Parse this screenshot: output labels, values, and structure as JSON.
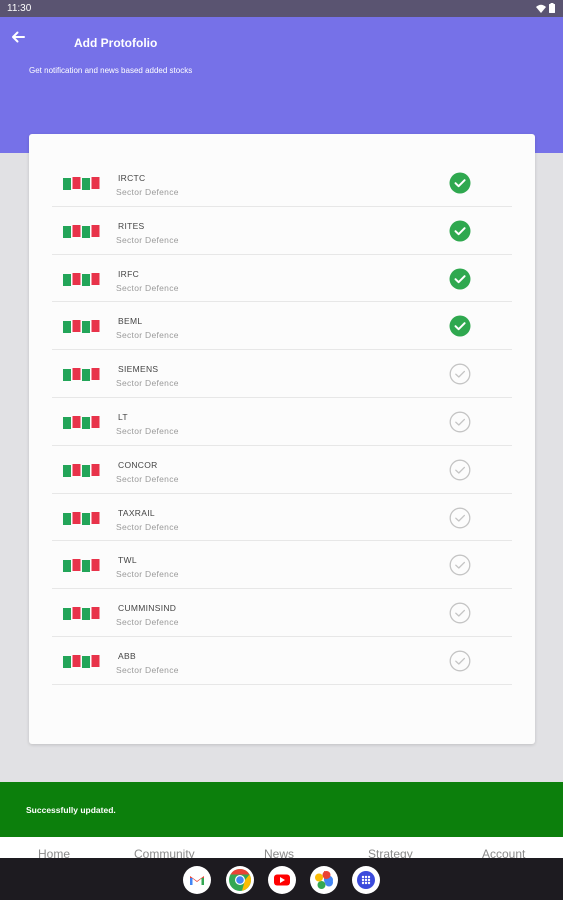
{
  "status_bar": {
    "time": "11:30"
  },
  "header": {
    "title": "Add Protofolio",
    "subtitle": "Get notification and news based added stocks"
  },
  "stocks": [
    {
      "name": "IRCTC",
      "sector": "Sector Defence",
      "selected": true
    },
    {
      "name": "RITES",
      "sector": "Sector Defence",
      "selected": true
    },
    {
      "name": "IRFC",
      "sector": "Sector Defence",
      "selected": true
    },
    {
      "name": "BEML",
      "sector": "Sector Defence",
      "selected": true
    },
    {
      "name": "SIEMENS",
      "sector": "Sector Defence",
      "selected": false
    },
    {
      "name": "LT",
      "sector": "Sector Defence",
      "selected": false
    },
    {
      "name": "CONCOR",
      "sector": "Sector Defence",
      "selected": false
    },
    {
      "name": "TAXRAIL",
      "sector": "Sector Defence",
      "selected": false
    },
    {
      "name": "TWL",
      "sector": "Sector Defence",
      "selected": false
    },
    {
      "name": "CUMMINSIND",
      "sector": "Sector Defence",
      "selected": false
    },
    {
      "name": "ABB",
      "sector": "Sector Defence",
      "selected": false
    }
  ],
  "snackbar": {
    "message": "Successfully updated."
  },
  "bottom_nav": [
    {
      "label": "Home",
      "icon": "home-icon"
    },
    {
      "label": "Community",
      "icon": "community-icon"
    },
    {
      "label": "News",
      "icon": "news-icon"
    },
    {
      "label": "Strategy",
      "icon": "strategy-icon"
    },
    {
      "label": "Account",
      "icon": "account-icon"
    }
  ],
  "dock": [
    {
      "icon": "gmail-icon"
    },
    {
      "icon": "chrome-icon"
    },
    {
      "icon": "youtube-icon"
    },
    {
      "icon": "photos-icon"
    },
    {
      "icon": "app-drawer-icon"
    }
  ],
  "colors": {
    "accent": "#7671e8",
    "success": "#0c7f0c",
    "check_selected": "#2fa84f",
    "check_unselected": "#c4c4c4",
    "candle_green": "#23a559",
    "candle_red": "#e8334a"
  }
}
